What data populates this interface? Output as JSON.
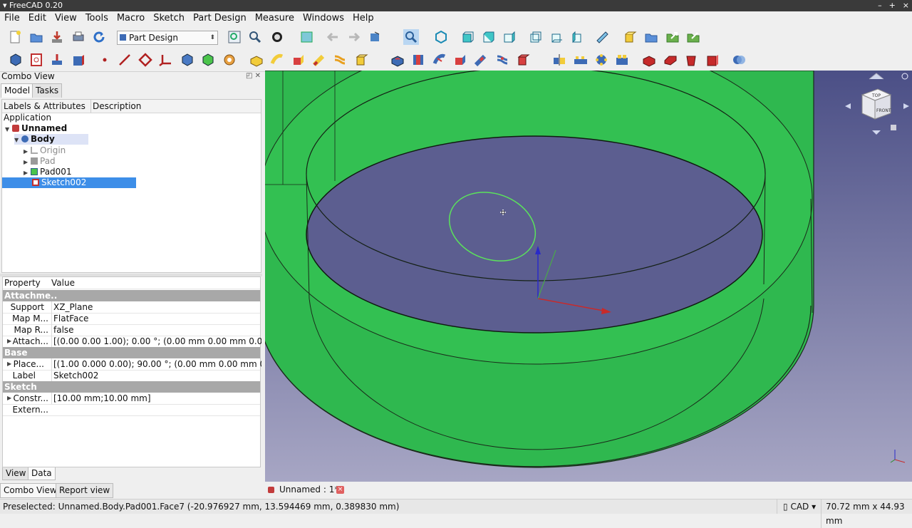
{
  "window": {
    "title": "FreeCAD 0.20",
    "controls": [
      "–",
      "+",
      "×"
    ]
  },
  "menu": [
    "File",
    "Edit",
    "View",
    "Tools",
    "Macro",
    "Sketch",
    "Part Design",
    "Measure",
    "Windows",
    "Help"
  ],
  "workbench": {
    "selected": "Part Design"
  },
  "combo_view": {
    "title": "Combo View",
    "tabs": [
      "Model",
      "Tasks"
    ],
    "tree": {
      "headers": [
        "Labels & Attributes",
        "Description"
      ],
      "root": "Application",
      "document": "Unnamed",
      "body": "Body",
      "items": [
        "Origin",
        "Pad",
        "Pad001",
        "Sketch002"
      ]
    },
    "properties": {
      "headers": [
        "Property",
        "Value"
      ],
      "groups": {
        "attachment": "Attachme..",
        "base": "Base",
        "sketch": "Sketch"
      },
      "rows": {
        "support": {
          "key": "Support",
          "value": "XZ_Plane"
        },
        "map_mode": {
          "key": "Map M...",
          "value": "FlatFace"
        },
        "map_reversed": {
          "key": "Map R...",
          "value": "false"
        },
        "attach_offset": {
          "key": "Attach...",
          "value": "[(0.00 0.00 1.00); 0.00 °; (0.00 mm  0.00 mm  0.00 ..."
        },
        "placement": {
          "key": "Place...",
          "value": "[(1.00 0.000 0.00); 90.00 °; (0.00 mm  0.00 mm  0.0..."
        },
        "label": {
          "key": "Label",
          "value": "Sketch002"
        },
        "constraints": {
          "key": "Constr...",
          "value": "[10.00 mm;10.00 mm]"
        },
        "external": {
          "key": "Extern...",
          "value": ""
        }
      },
      "view_tabs": [
        "View",
        "Data"
      ]
    }
  },
  "bottom_tabs": [
    "Combo View",
    "Report view"
  ],
  "document_tab": {
    "label": "Unnamed : 1*",
    "close": "×"
  },
  "navcube": {
    "top_label": "TOP",
    "front_label": "FRONT"
  },
  "status": {
    "message": "Preselected: Unnamed.Body.Pad001.Face7 (-20.976927 mm, 13.594469 mm, 0.389830 mm)",
    "navigation": "CAD",
    "dimensions": "70.72 mm x 44.93 mm"
  },
  "colors": {
    "solid": "#2fb84f",
    "edge": "#1a2a1a",
    "background_top": "#4b4f86",
    "background_bottom": "#a7a6c4",
    "sketch": "#5be35b",
    "selection": "#3d8ee8"
  }
}
